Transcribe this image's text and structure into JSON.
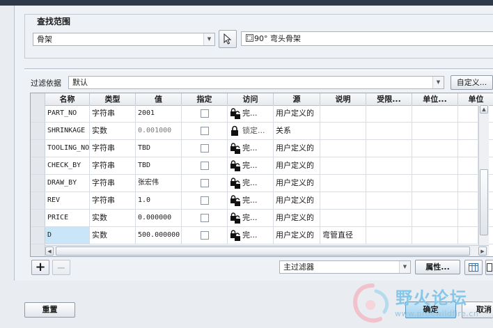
{
  "window": {
    "title_fragment": ""
  },
  "search": {
    "group_label": "查找范围",
    "scope_value": "骨架",
    "reference": "90° 弯头骨架"
  },
  "filter": {
    "label": "过滤依据",
    "value": "默认",
    "customize_label": "自定义..."
  },
  "table": {
    "headers": [
      "名称",
      "类型",
      "值",
      "指定",
      "访问",
      "源",
      "说明",
      "受限...",
      "单位...",
      "单位"
    ],
    "rows": [
      {
        "name": "PART_NO",
        "type": "字符串",
        "value": "2001",
        "designate": false,
        "access": "完...",
        "locked": false,
        "source": "用户定义的",
        "description": "",
        "dim": false
      },
      {
        "name": "SHRINKAGE",
        "type": "实数",
        "value": "0.001000",
        "designate": false,
        "access": "锁定...",
        "locked": true,
        "source": "关系",
        "description": "",
        "dim": true
      },
      {
        "name": "TOOLING_NO",
        "type": "字符串",
        "value": "TBD",
        "designate": false,
        "access": "完...",
        "locked": false,
        "source": "用户定义的",
        "description": "",
        "dim": false
      },
      {
        "name": "CHECK_BY",
        "type": "字符串",
        "value": "TBD",
        "designate": false,
        "access": "完...",
        "locked": false,
        "source": "用户定义的",
        "description": "",
        "dim": false
      },
      {
        "name": "DRAW_BY",
        "type": "字符串",
        "value": "张宏伟",
        "designate": false,
        "access": "完...",
        "locked": false,
        "source": "用户定义的",
        "description": "",
        "dim": false
      },
      {
        "name": "REV",
        "type": "字符串",
        "value": "1.0",
        "designate": false,
        "access": "完...",
        "locked": false,
        "source": "用户定义的",
        "description": "",
        "dim": false
      },
      {
        "name": "PRICE",
        "type": "实数",
        "value": "0.000000",
        "designate": false,
        "access": "完...",
        "locked": false,
        "source": "用户定义的",
        "description": "",
        "dim": false
      },
      {
        "name": "D",
        "type": "实数",
        "value": "500.000000",
        "designate": false,
        "access": "完...",
        "locked": false,
        "source": "用户定义的",
        "description": "弯管直径",
        "dim": false,
        "selected": true
      }
    ]
  },
  "toolbar": {
    "add_symbol": "+",
    "remove_symbol": "−",
    "main_filter": "主过滤器",
    "properties_label": "属性..."
  },
  "footer": {
    "reset_label": "重置",
    "ok_label": "确定",
    "cancel_label": "取消"
  },
  "watermark": {
    "text": "野火论坛",
    "url": "www.proewildfire.cn"
  },
  "colors": {
    "selected_cell": "#c9e6f8",
    "ok_button": "#9fd0ef",
    "watermark": "#86c6e8"
  }
}
